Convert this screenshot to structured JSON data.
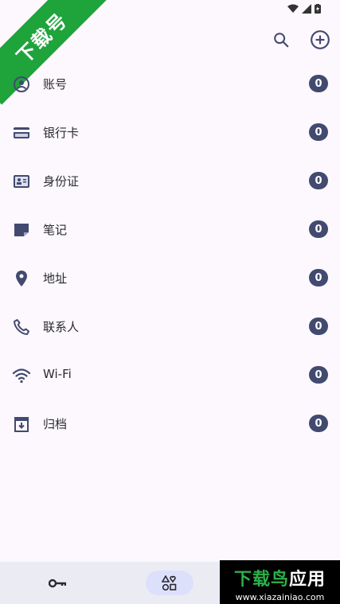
{
  "watermark": {
    "ribbon": "下载号",
    "brand_green": "下载鸟",
    "brand_white": "应用",
    "url": "www.xiazainiao.com"
  },
  "topbar": {
    "search_icon": "search-icon",
    "add_icon": "add-circle-icon"
  },
  "categories": [
    {
      "label": "账号",
      "count": "0",
      "icon": "account-icon"
    },
    {
      "label": "银行卡",
      "count": "0",
      "icon": "credit-card-icon"
    },
    {
      "label": "身份证",
      "count": "0",
      "icon": "id-card-icon"
    },
    {
      "label": "笔记",
      "count": "0",
      "icon": "note-icon"
    },
    {
      "label": "地址",
      "count": "0",
      "icon": "location-icon"
    },
    {
      "label": "联系人",
      "count": "0",
      "icon": "phone-icon"
    },
    {
      "label": "Wi-Fi",
      "count": "0",
      "icon": "wifi-icon"
    },
    {
      "label": "归档",
      "count": "0",
      "icon": "archive-icon"
    }
  ],
  "bottom_nav": [
    {
      "icon": "key-icon",
      "active": false
    },
    {
      "icon": "categories-icon",
      "active": true
    }
  ],
  "colors": {
    "background": "#fcf8fd",
    "badge": "#434a70",
    "icon": "#434a70",
    "active_nav": "#dde0fb"
  }
}
